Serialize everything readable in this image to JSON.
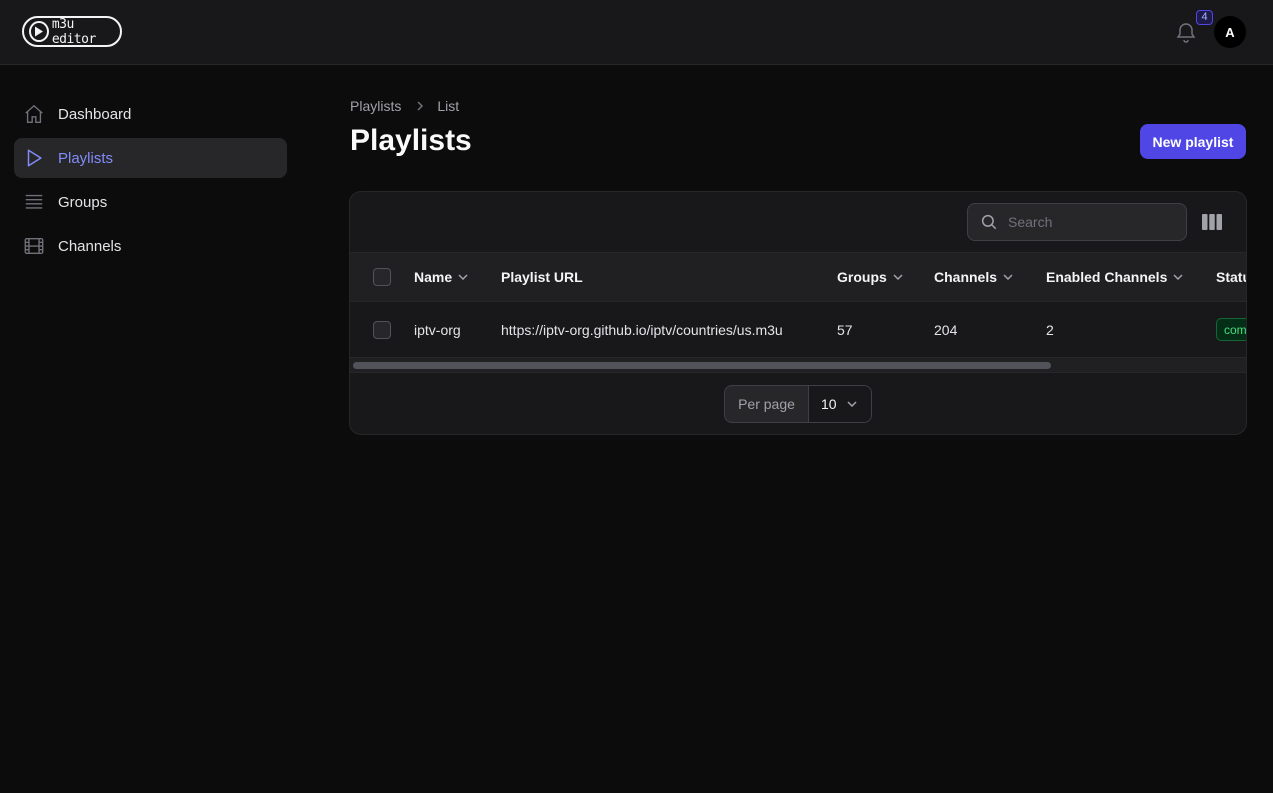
{
  "app": {
    "logo_text": "m3u editor"
  },
  "header": {
    "notification_count": "4",
    "avatar_initial": "A"
  },
  "sidebar": {
    "items": [
      {
        "label": "Dashboard",
        "icon": "home-icon",
        "active": false
      },
      {
        "label": "Playlists",
        "icon": "play-icon",
        "active": true
      },
      {
        "label": "Groups",
        "icon": "list-icon",
        "active": false
      },
      {
        "label": "Channels",
        "icon": "film-icon",
        "active": false
      }
    ]
  },
  "breadcrumb": {
    "root": "Playlists",
    "current": "List"
  },
  "page": {
    "title": "Playlists",
    "new_button": "New playlist"
  },
  "table": {
    "search_placeholder": "Search",
    "columns": [
      "Name",
      "Playlist URL",
      "Groups",
      "Channels",
      "Enabled Channels",
      "Statu"
    ],
    "rows": [
      {
        "name": "iptv-org",
        "url": "https://iptv-org.github.io/iptv/countries/us.m3u",
        "groups": "57",
        "channels": "204",
        "enabled_channels": "2",
        "status": "com"
      }
    ],
    "per_page_label": "Per page",
    "per_page_value": "10"
  },
  "colors": {
    "accent": "#4f46e5",
    "active_nav": "#818cf8",
    "status_green": "#4ade80"
  }
}
